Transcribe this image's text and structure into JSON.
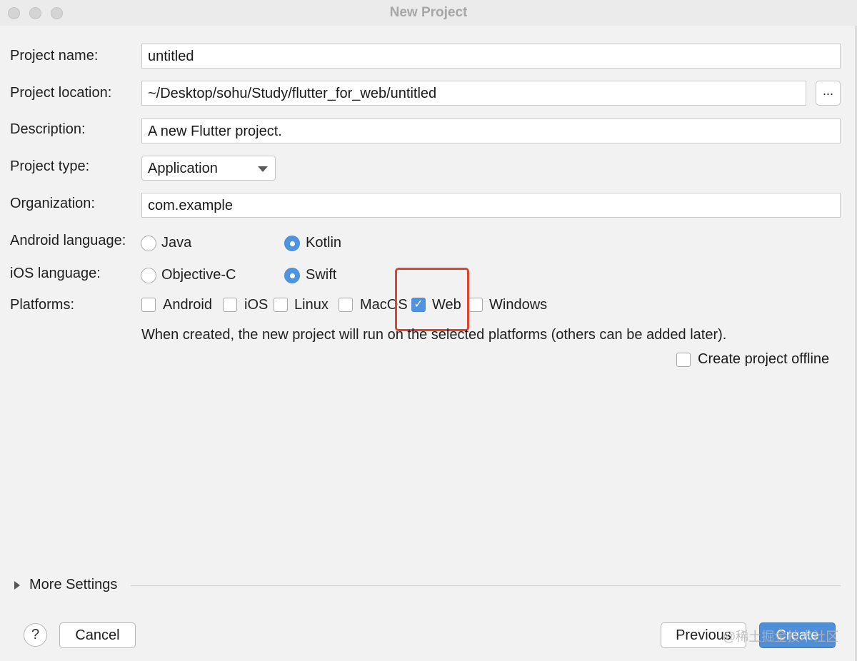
{
  "window": {
    "title": "New Project"
  },
  "form": {
    "project_name": {
      "label": "Project name:",
      "value": "untitled"
    },
    "project_location": {
      "label": "Project location:",
      "value": "~/Desktop/sohu/Study/flutter_for_web/untitled",
      "browse_label": "..."
    },
    "description": {
      "label": "Description:",
      "value": "A new Flutter project."
    },
    "project_type": {
      "label": "Project type:",
      "value": "Application"
    },
    "organization": {
      "label": "Organization:",
      "value": "com.example"
    },
    "android_language": {
      "label": "Android language:",
      "options": [
        "Java",
        "Kotlin"
      ],
      "selected": "Kotlin"
    },
    "ios_language": {
      "label": "iOS language:",
      "options": [
        "Objective-C",
        "Swift"
      ],
      "selected": "Swift"
    },
    "platforms": {
      "label": "Platforms:",
      "items": [
        {
          "label": "Android",
          "checked": false
        },
        {
          "label": "iOS",
          "checked": false
        },
        {
          "label": "Linux",
          "checked": false
        },
        {
          "label": "MacOS",
          "checked": false
        },
        {
          "label": "Web",
          "checked": true
        },
        {
          "label": "Windows",
          "checked": false
        }
      ],
      "note": "When created, the new project will run on the selected platforms (others can be added later)."
    },
    "offline": {
      "label": "Create project offline",
      "checked": false
    }
  },
  "more_settings": {
    "label": "More Settings"
  },
  "footer": {
    "help_label": "?",
    "cancel_label": "Cancel",
    "previous_label": "Previous",
    "create_label": "Create",
    "watermark": "@稀土掘金技术社区"
  },
  "colors": {
    "accent": "#4f94e2",
    "highlight": "#e0442f"
  }
}
